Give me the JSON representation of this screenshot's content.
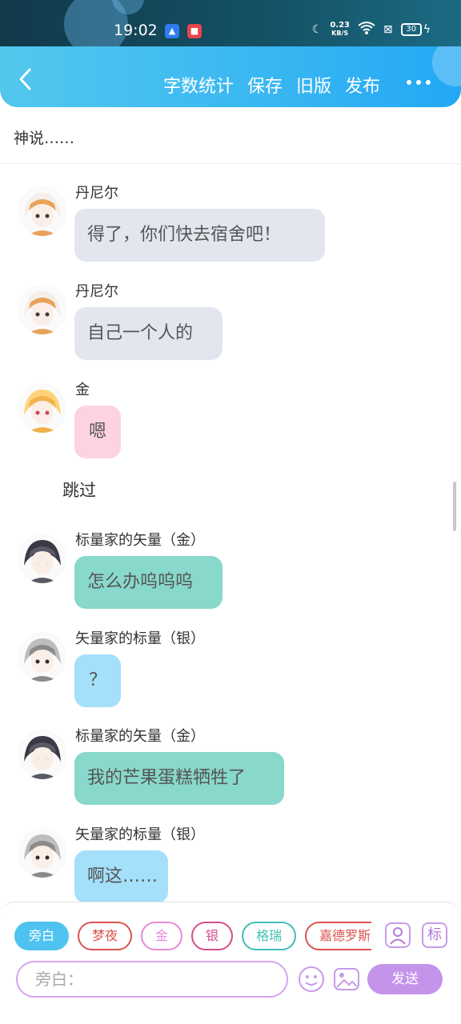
{
  "status_bar": {
    "time": "19:02",
    "network_speed": "0.23",
    "network_unit": "KB/S",
    "battery": "30"
  },
  "header": {
    "actions": [
      "字数统计",
      "保存",
      "旧版",
      "发布"
    ]
  },
  "story": {
    "title": "神说……"
  },
  "messages": [
    {
      "kind": "chat",
      "name": "丹尼尔",
      "text": "得了，你们快去宿舍吧！",
      "bubble_color": "#e3e6ef",
      "avatar_style": "white-hair"
    },
    {
      "kind": "chat",
      "name": "丹尼尔",
      "text": "自己一个人的",
      "bubble_color": "#e3e6ef",
      "avatar_style": "white-hair"
    },
    {
      "kind": "chat",
      "name": "金",
      "text": "嗯",
      "bubble_color": "#fdd3df",
      "avatar_style": "blonde"
    },
    {
      "kind": "narration",
      "text": "跳过"
    },
    {
      "kind": "chat",
      "name": "标量家的矢量（金）",
      "text": "怎么办呜呜呜",
      "bubble_color": "#88d8cb",
      "avatar_style": "dark-hair"
    },
    {
      "kind": "chat",
      "name": "矢量家的标量（银）",
      "text": "？",
      "bubble_color": "#a4e0fa",
      "avatar_style": "gray-hair"
    },
    {
      "kind": "chat",
      "name": "标量家的矢量（金）",
      "text": "我的芒果蛋糕牺牲了",
      "bubble_color": "#88d8cb",
      "avatar_style": "dark-hair"
    },
    {
      "kind": "chat",
      "name": "矢量家的标量（银）",
      "text": "啊这……",
      "bubble_color": "#a4e0fa",
      "avatar_style": "gray-hair"
    }
  ],
  "role_chips": [
    {
      "label": "旁白",
      "color": "#4fc3f0",
      "selected": true
    },
    {
      "label": "梦夜",
      "color": "#d9534f",
      "selected": false
    },
    {
      "label": "金",
      "color": "#e58ad8",
      "selected": false
    },
    {
      "label": "银",
      "color": "#d24f8c",
      "selected": false
    },
    {
      "label": "格瑞",
      "color": "#3fc0b5",
      "selected": false
    },
    {
      "label": "嘉德罗斯",
      "color": "#d9534f",
      "selected": false
    }
  ],
  "tools": {
    "role_icon": "person-card-icon",
    "tag_label": "标"
  },
  "composer": {
    "placeholder": "旁白：",
    "send_label": "发送"
  }
}
